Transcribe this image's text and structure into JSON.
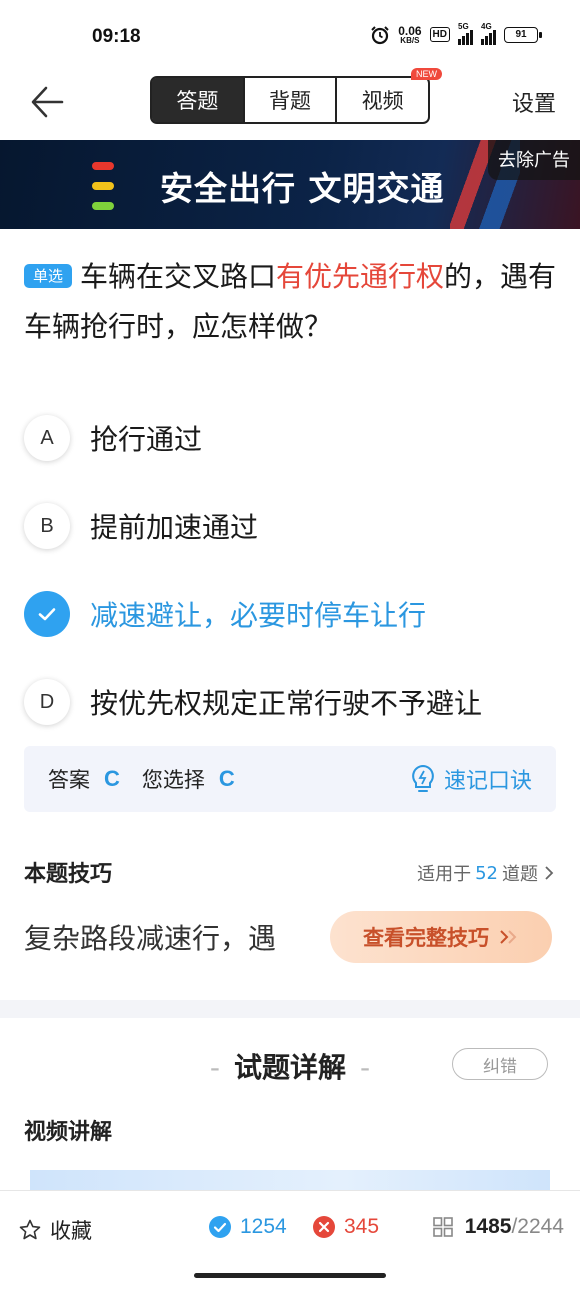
{
  "status": {
    "time": "09:18",
    "net_speed": "0.06",
    "net_unit": "KB/S",
    "hd": "HD",
    "signal1": "5G",
    "signal2": "4G",
    "battery": "91"
  },
  "nav": {
    "tabs": [
      "答题",
      "背题",
      "视频"
    ],
    "new_badge": "NEW",
    "settings": "设置"
  },
  "banner": {
    "text": "安全出行 文明交通",
    "remove_ad": "去除广告",
    "light_colors": [
      "#e8372d",
      "#f2c21b",
      "#7fd13b"
    ]
  },
  "question": {
    "type_badge": "单选",
    "text_before": "车辆在交叉路口",
    "text_highlight": "有优先通行权",
    "text_after": "的，遇有车辆抢行时，应怎样做？"
  },
  "options": [
    {
      "letter": "A",
      "text": "抢行通过"
    },
    {
      "letter": "B",
      "text": "提前加速通过"
    },
    {
      "letter": "C",
      "text": "减速避让，必要时停车让行"
    },
    {
      "letter": "D",
      "text": "按优先权规定正常行驶不予避让"
    }
  ],
  "answer": {
    "answer_label": "答案",
    "answer_value": "C",
    "choice_label": "您选择",
    "choice_value": "C",
    "memo": "速记口诀"
  },
  "tips": {
    "title": "本题技巧",
    "applies_prefix": "适用于",
    "applies_count": "52",
    "applies_suffix": "道题",
    "text": "复杂路段减速行，遇",
    "button": "查看完整技巧"
  },
  "detail": {
    "title": "试题详解",
    "correct_button": "纠错",
    "video_title": "视频讲解"
  },
  "bottom": {
    "favorite": "收藏",
    "correct_count": "1254",
    "wrong_count": "345",
    "current": "1485",
    "total": "/2244"
  },
  "colors": {
    "accent": "#2fa2f0",
    "error": "#e5473a",
    "tip_button": "#fbcfb0"
  }
}
